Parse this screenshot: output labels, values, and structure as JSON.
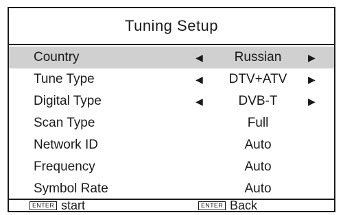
{
  "title": "Tuning Setup",
  "rows": [
    {
      "label": "Country",
      "value": "Russian",
      "left_arrow": "◀",
      "right_arrow": "▶"
    },
    {
      "label": "Tune Type",
      "value": "DTV+ATV",
      "left_arrow": "◀",
      "right_arrow": "▶"
    },
    {
      "label": "Digital Type",
      "value": "DVB-T",
      "left_arrow": "◀",
      "right_arrow": "▶"
    },
    {
      "label": "Scan Type",
      "value": "Full"
    },
    {
      "label": "Network ID",
      "value": "Auto"
    },
    {
      "label": "Frequency",
      "value": "Auto"
    },
    {
      "label": "Symbol Rate",
      "value": "Auto"
    }
  ],
  "selected_row": "Country",
  "footer": {
    "start": {
      "key": "ENTER",
      "label": "start"
    },
    "back": {
      "key": "ENTER",
      "label": "Back"
    }
  },
  "colors": {
    "selected_background": "#d0d0d0",
    "border": "#1a1a1a",
    "background": "#ffffff"
  },
  "icons": {
    "left": "triangle-left-icon",
    "right": "triangle-right-icon"
  }
}
